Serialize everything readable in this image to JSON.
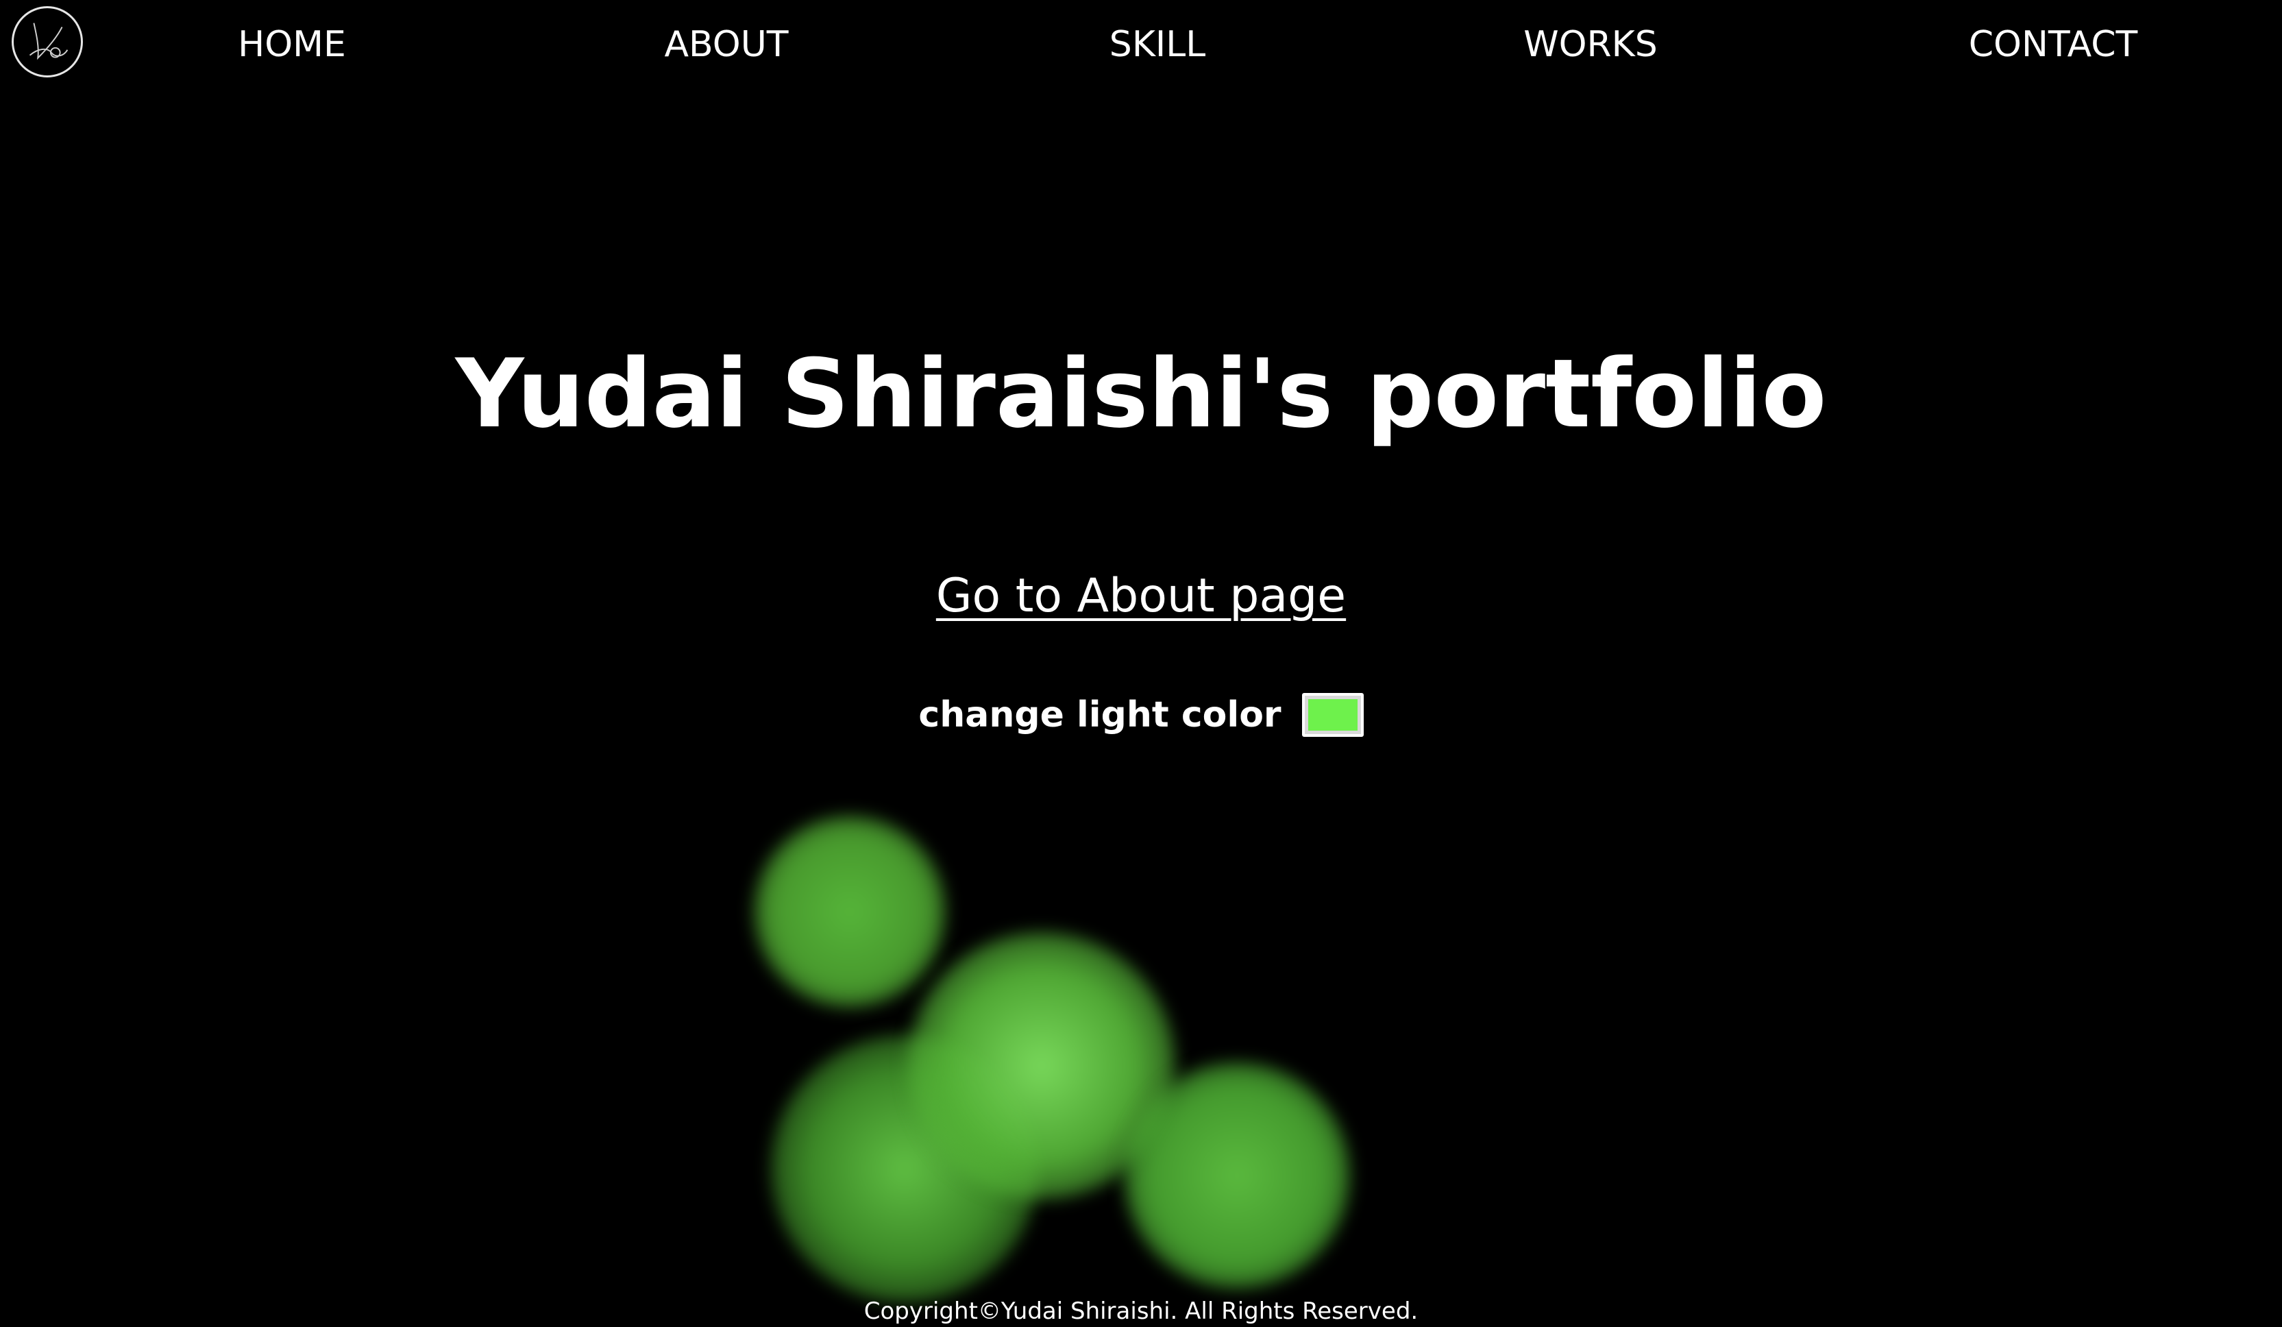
{
  "header": {
    "nav": [
      {
        "label": "HOME"
      },
      {
        "label": "ABOUT"
      },
      {
        "label": "SKILL"
      },
      {
        "label": "WORKS"
      },
      {
        "label": "CONTACT"
      }
    ]
  },
  "hero": {
    "title": "Yudai Shiraishi's portfolio",
    "about_link": "Go to About page",
    "color_label": "change light color",
    "light_color": "#6ef14c"
  },
  "footer": {
    "copyright": "Copyright©Yudai Shiraishi. All Rights Reserved."
  },
  "colors": {
    "background": "#000000",
    "text": "#ffffff",
    "light": "#6ef14c"
  }
}
